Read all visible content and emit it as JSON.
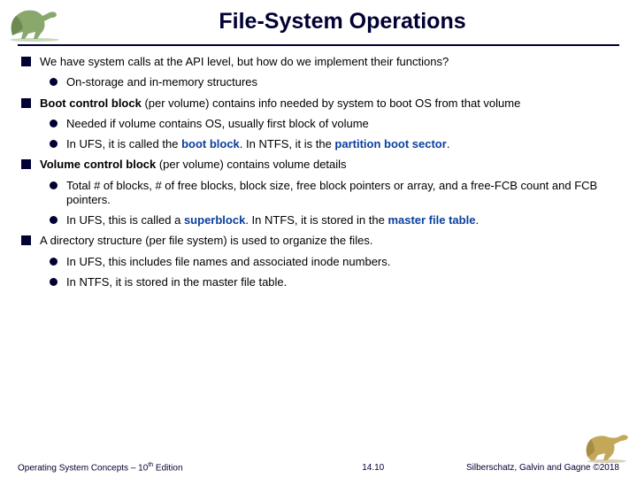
{
  "title": "File-System Operations",
  "b1": {
    "text": "We have system calls at the API level, but how do we implement their functions?",
    "sub": [
      {
        "text": "On-storage and in-memory structures"
      }
    ]
  },
  "b2": {
    "pre": "Boot control block",
    "post": " (per volume) contains info needed by system to boot OS from that volume",
    "sub": [
      {
        "text": "Needed if volume contains OS, usually first block of volume"
      },
      {
        "pre": "In UFS, it is called the ",
        "t1": "boot block",
        "mid": ". In NTFS, it is the ",
        "t2": "partition boot sector",
        "post": "."
      }
    ]
  },
  "b3": {
    "pre": "Volume control block",
    "post": " (per volume) contains volume details",
    "sub": [
      {
        "text": "Total # of blocks, # of free blocks, block size, free block pointers or array, and a free-FCB count and FCB pointers."
      },
      {
        "pre": "In UFS, this is called a ",
        "t1": "superblock",
        "mid": ". In NTFS, it is stored in the ",
        "t2": "master file table",
        "post": "."
      }
    ]
  },
  "b4": {
    "text": "A directory structure (per file system) is used to organize the files.",
    "sub": [
      {
        "text": "In UFS, this includes file names and associated inode numbers."
      },
      {
        "text": "In NTFS, it is stored in the master file table."
      }
    ]
  },
  "footer": {
    "left_pre": "Operating System Concepts – 10",
    "left_sup": "th",
    "left_post": " Edition",
    "mid": "14.10",
    "right": "Silberschatz, Galvin and Gagne ©2018"
  }
}
